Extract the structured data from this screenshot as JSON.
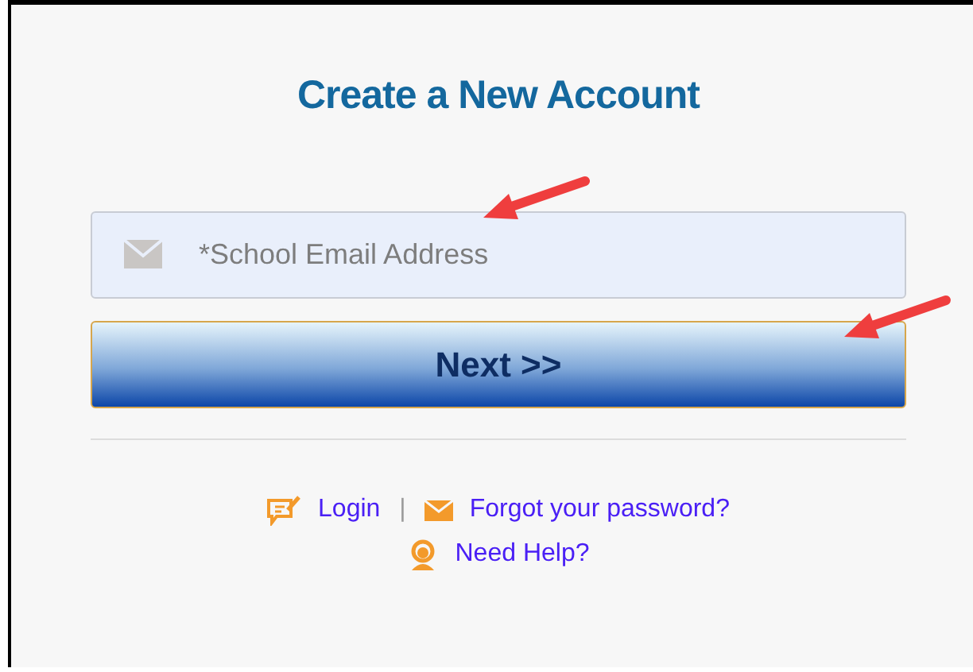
{
  "title": "Create a New Account",
  "email_field": {
    "placeholder": "*School Email Address"
  },
  "next_button": {
    "label": "Next >>"
  },
  "links": [
    {
      "kind": "login",
      "label": "Login"
    },
    {
      "kind": "forgot",
      "label": "Forgot your password?"
    }
  ],
  "separator": "|",
  "help_link": {
    "label": "Need Help?"
  }
}
